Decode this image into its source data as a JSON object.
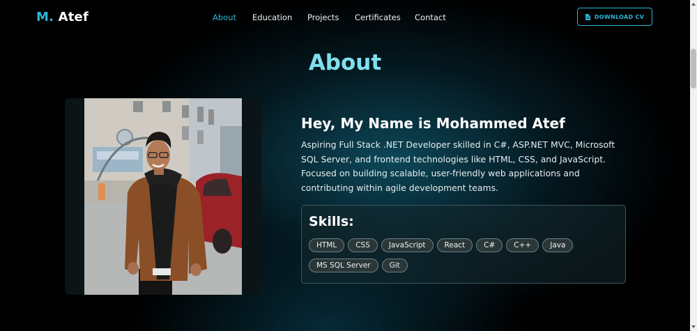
{
  "brand": {
    "initial": "M.",
    "name": "Atef"
  },
  "nav": {
    "items": [
      {
        "label": "About",
        "active": true
      },
      {
        "label": "Education",
        "active": false
      },
      {
        "label": "Projects",
        "active": false
      },
      {
        "label": "Certificates",
        "active": false
      },
      {
        "label": "Contact",
        "active": false
      }
    ],
    "cv_button": "DOWNLOAD CV"
  },
  "about": {
    "title": "About",
    "heading": "Hey, My Name is Mohammed Atef",
    "bio": "Aspiring Full Stack .NET Developer skilled in C#, ASP.NET MVC, Microsoft SQL Server, and frontend technologies like HTML, CSS, and JavaScript. Focused on building scalable, user-friendly web applications and contributing within agile development teams."
  },
  "skills": {
    "title": "Skills:",
    "items": [
      "HTML",
      "CSS",
      "JavaScript",
      "React",
      "C#",
      "C++",
      "Java",
      "MS SQL Server",
      "Git"
    ]
  },
  "colors": {
    "accent": "#2cb6d6",
    "title": "#7ee0ee",
    "background": "#000000"
  },
  "icons": {
    "cv": "file-icon"
  }
}
